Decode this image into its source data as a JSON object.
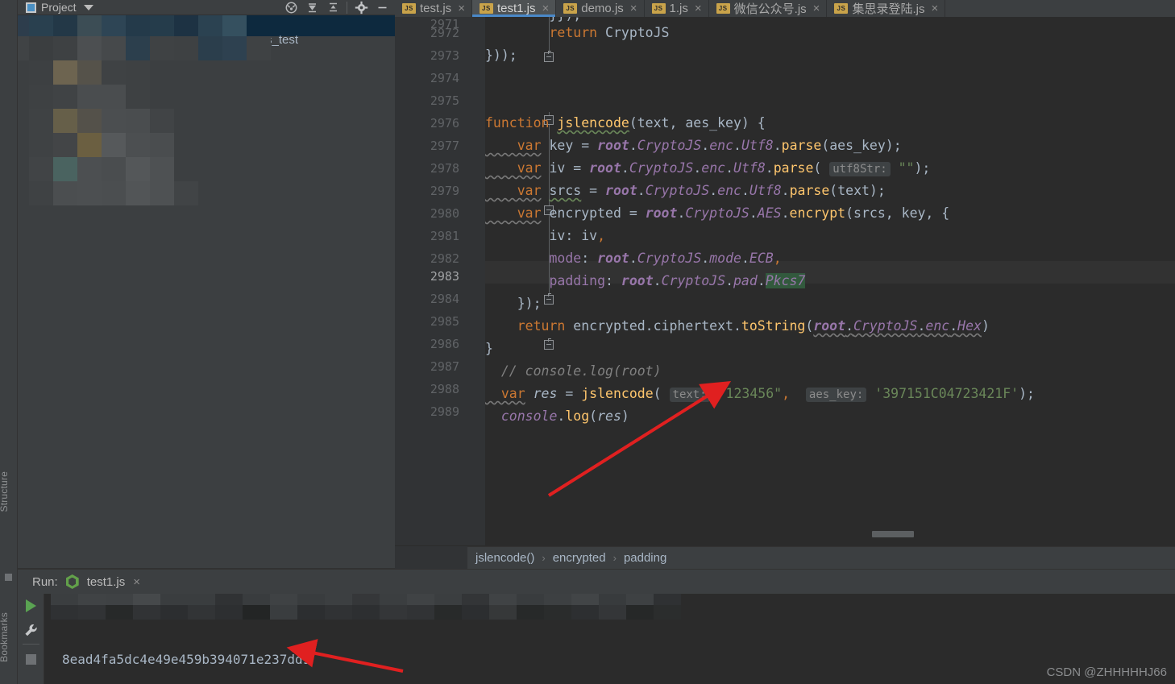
{
  "project_panel": {
    "title": "Project",
    "icon": "project-folder-icon",
    "dropdown_icon": "chevron-down-icon",
    "tools": [
      {
        "name": "locate-icon",
        "label": "Select Opened File"
      },
      {
        "name": "collapse-all-icon",
        "label": "Collapse All"
      },
      {
        "name": "expand-all-icon",
        "label": "Expand All"
      },
      {
        "name": "gear-icon",
        "label": "Settings"
      },
      {
        "name": "minimize-icon",
        "label": "Hide"
      }
    ],
    "selected_tree_item": "s_test"
  },
  "left_rail": {
    "structure_label": "Structure",
    "bookmarks_label": "Bookmarks"
  },
  "editor": {
    "tabs": [
      {
        "label": "test.js",
        "badge": "JS",
        "active": false,
        "close": "×"
      },
      {
        "label": "test1.js",
        "badge": "JS",
        "active": true,
        "close": "×"
      },
      {
        "label": "demo.js",
        "badge": "JS",
        "active": false,
        "close": "×"
      },
      {
        "label": "1.js",
        "badge": "JS",
        "active": false,
        "close": "×"
      },
      {
        "label": "微信公众号.js",
        "badge": "JS",
        "active": false,
        "close": "×"
      },
      {
        "label": "集思录登陆.js",
        "badge": "JS",
        "active": false,
        "close": "×"
      }
    ],
    "line_numbers": [
      "2971",
      "2972",
      "2973",
      "2974",
      "2975",
      "2976",
      "2977",
      "2978",
      "2979",
      "2980",
      "2981",
      "2982",
      "2983",
      "2984",
      "2985",
      "2986",
      "2987",
      "2988",
      "2989"
    ],
    "current_line": "2983",
    "code_lines": [
      {
        "n": "2972",
        "text": "        return CryptoJS"
      },
      {
        "n": "2973",
        "text": "}));"
      },
      {
        "n": "2974",
        "text": ""
      },
      {
        "n": "2975",
        "text": ""
      },
      {
        "n": "2976",
        "text": "function jslencode(text, aes_key) {"
      },
      {
        "n": "2977",
        "text": "    var key = root.CryptoJS.enc.Utf8.parse(aes_key);"
      },
      {
        "n": "2978",
        "text": "    var iv = root.CryptoJS.enc.Utf8.parse( utf8Str: \"\");"
      },
      {
        "n": "2979",
        "text": "    var srcs = root.CryptoJS.enc.Utf8.parse(text);"
      },
      {
        "n": "2980",
        "text": "    var encrypted = root.CryptoJS.AES.encrypt(srcs, key, {"
      },
      {
        "n": "2981",
        "text": "        iv: iv,"
      },
      {
        "n": "2982",
        "text": "        mode: root.CryptoJS.mode.ECB,"
      },
      {
        "n": "2983",
        "text": "        padding: root.CryptoJS.pad.Pkcs7"
      },
      {
        "n": "2984",
        "text": "    });"
      },
      {
        "n": "2985",
        "text": "    return encrypted.ciphertext.toString(root.CryptoJS.enc.Hex)"
      },
      {
        "n": "2986",
        "text": "}"
      },
      {
        "n": "2987",
        "text": "// console.log(root)"
      },
      {
        "n": "2988",
        "text": "var res = jslencode( text: \"123456\",  aes_key: '397151C04723421F');"
      },
      {
        "n": "2989",
        "text": "console.log(res)"
      }
    ],
    "parameter_hints": {
      "utf8str": "utf8Str:",
      "text": "text:",
      "aes_key": "aes_key:"
    },
    "selected_token": "Pkcs7",
    "breadcrumb": [
      "jslencode()",
      "encrypted",
      "padding"
    ],
    "breadcrumb_separator": "›"
  },
  "run_panel": {
    "label": "Run:",
    "tab_name": "test1.js",
    "tab_icon": "nodejs-icon",
    "tab_close": "×",
    "toolbar": [
      {
        "name": "rerun-icon",
        "label": "Rerun"
      },
      {
        "name": "wrench-icon",
        "label": "Edit Configuration"
      },
      {
        "name": "stop-icon",
        "label": "Stop"
      }
    ],
    "console_output": "8ead4fa5dc4e49e459b394071e237dd9"
  },
  "watermark": "CSDN @ZHHHHHJ66",
  "colors": {
    "editor_bg": "#2b2b2b",
    "panel_bg": "#3c3f41",
    "gutter_bg": "#313335",
    "accent_tab": "#4a88c7",
    "keyword": "#cc7832",
    "string": "#6a8759",
    "field": "#9876aa",
    "function": "#ffc66d",
    "default_text": "#a9b7c6",
    "comment": "#808080",
    "selection_green": "#32593d",
    "arrow_red": "#e02020",
    "run_green": "#5aa352",
    "tree_selected": "#0d293e"
  }
}
